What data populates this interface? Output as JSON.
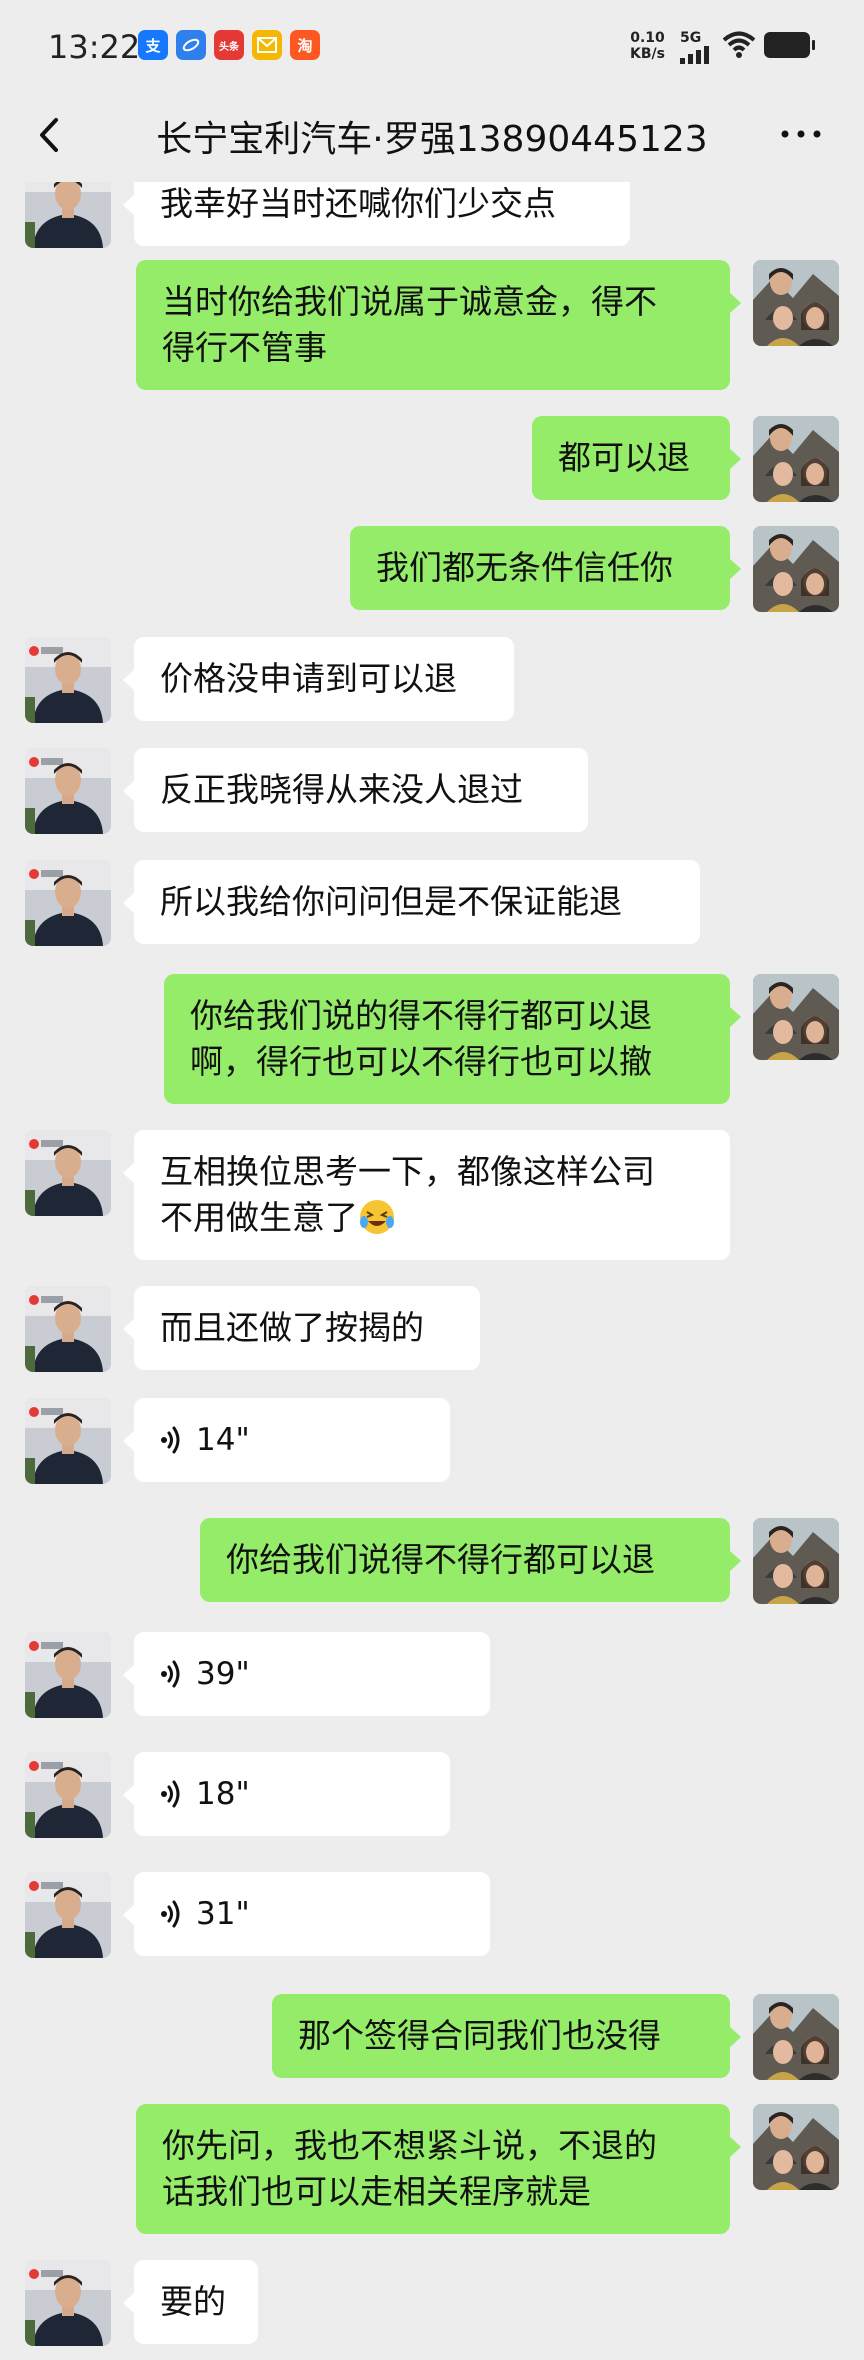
{
  "status_bar": {
    "time": "13:22",
    "speed_value": "0.10",
    "speed_unit": "KB/s",
    "network": "5G",
    "notification_icons": [
      "alipay-icon",
      "browser-icon",
      "toutiao-icon",
      "mail-icon",
      "taobao-icon"
    ],
    "notification_labels": [
      "支",
      "",
      "头条",
      "",
      "淘"
    ]
  },
  "header": {
    "title": "长宁宝利汽车·罗强13890445123",
    "more_label": "···"
  },
  "colors": {
    "background": "#ededed",
    "sent_bubble": "#95ec69",
    "received_bubble": "#ffffff"
  },
  "messages": [
    {
      "side": "left",
      "text": "我幸好当时还喊你们少交点"
    },
    {
      "side": "right",
      "text": "当时你给我们说属于诚意金，得不\n得行不管事"
    },
    {
      "side": "right",
      "text": "都可以退"
    },
    {
      "side": "right",
      "text": "我们都无条件信任你"
    },
    {
      "side": "left",
      "text": "价格没申请到可以退"
    },
    {
      "side": "left",
      "text": "反正我晓得从来没人退过"
    },
    {
      "side": "left",
      "text": "所以我给你问问但是不保证能退"
    },
    {
      "side": "right",
      "text": "你给我们说的得不得行都可以退\n啊，得行也可以不得行也可以撤"
    },
    {
      "side": "left",
      "text": "互相换位思考一下，都像这样公司\n不用做生意了"
    },
    {
      "side": "left",
      "text": "而且还做了按揭的"
    },
    {
      "side": "left",
      "type": "voice",
      "text": "14\""
    },
    {
      "side": "right",
      "text": "你给我们说得不得行都可以退"
    },
    {
      "side": "left",
      "type": "voice",
      "text": "39\""
    },
    {
      "side": "left",
      "type": "voice",
      "text": "18\""
    },
    {
      "side": "left",
      "type": "voice",
      "text": "31\""
    },
    {
      "side": "right",
      "text": "那个签得合同我们也没得"
    },
    {
      "side": "right",
      "text": "你先问，我也不想紧斗说，不退的\n话我们也可以走相关程序就是"
    },
    {
      "side": "left",
      "text": "要的"
    }
  ]
}
